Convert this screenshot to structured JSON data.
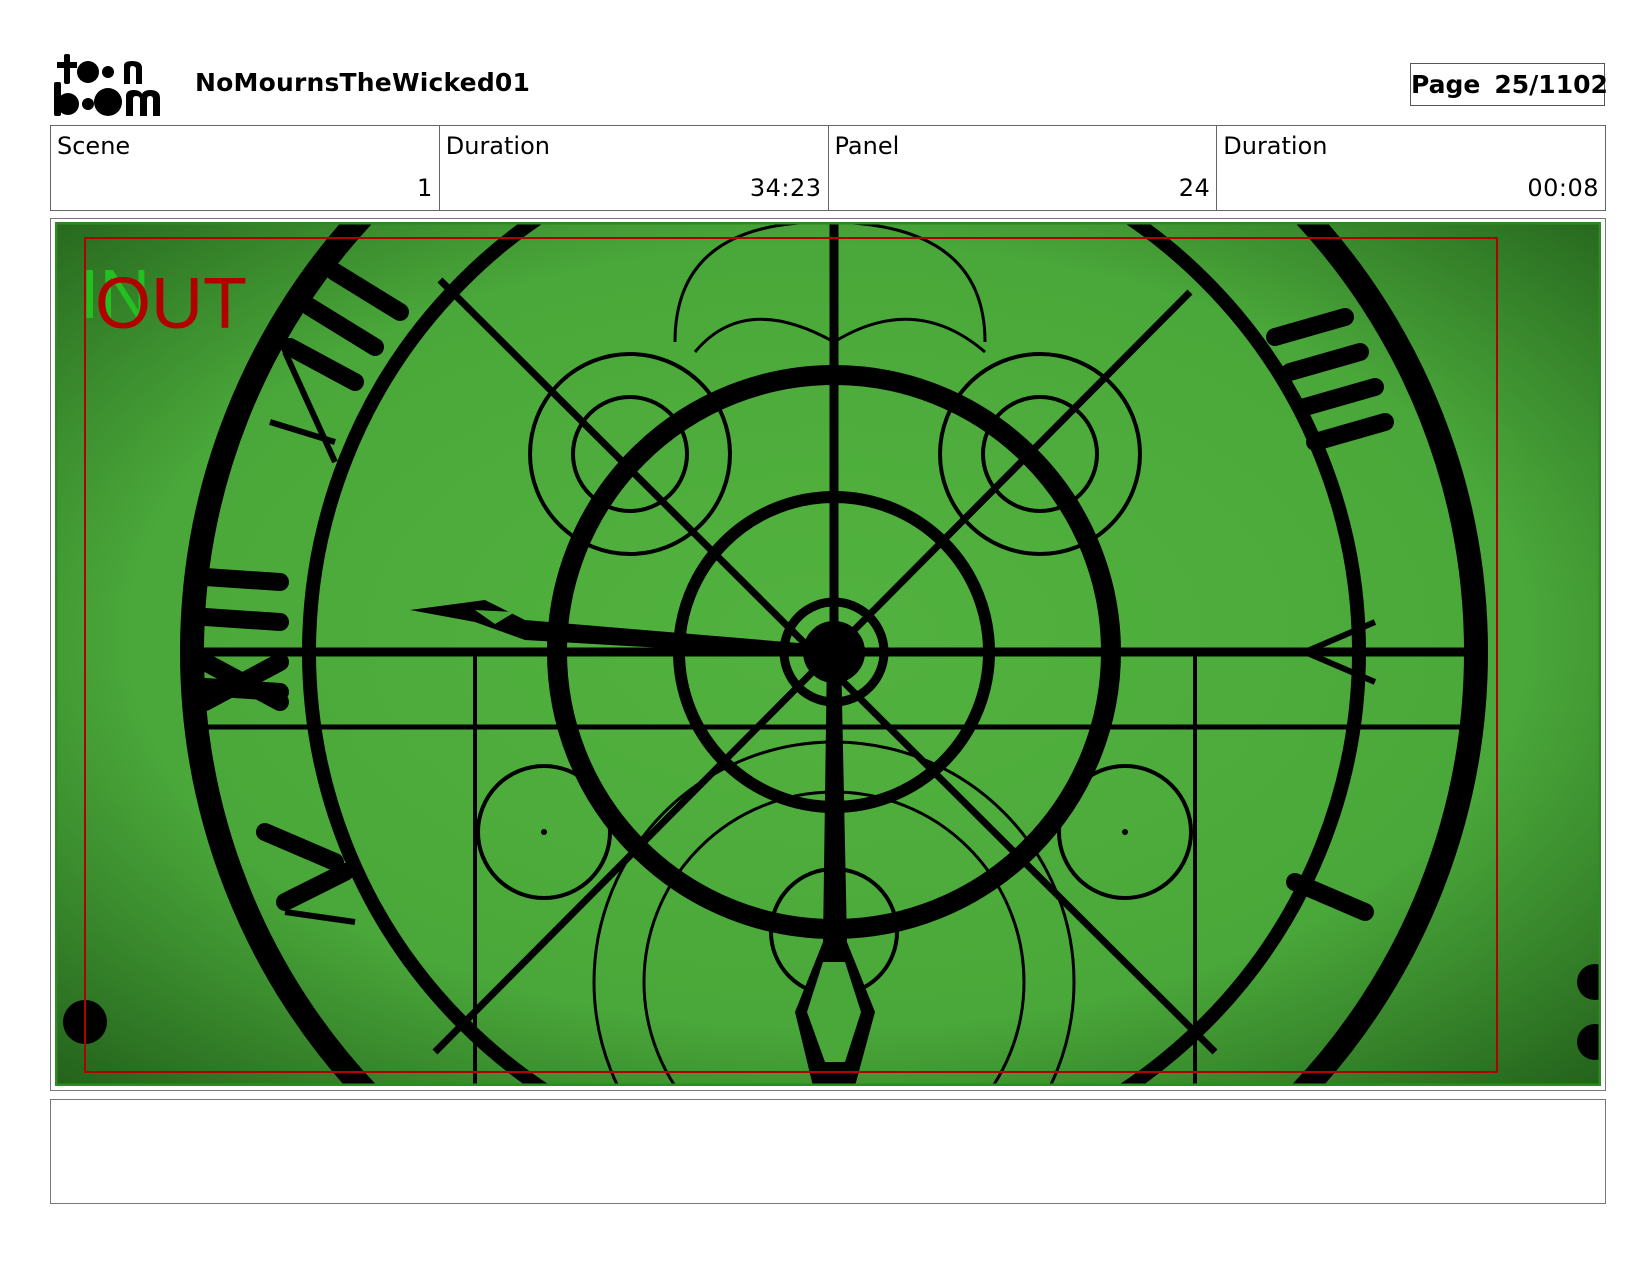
{
  "header": {
    "logo_alt": "toon boom",
    "project_title": "NoMournsTheWicked01",
    "page_label": "Page",
    "page_number": "25/1102"
  },
  "info": {
    "scene_label": "Scene",
    "scene_value": "1",
    "scene_duration_label": "Duration",
    "scene_duration_value": "34:23",
    "panel_label": "Panel",
    "panel_value": "24",
    "panel_duration_label": "Duration",
    "panel_duration_value": "00:08"
  },
  "panel": {
    "in_label": "IN",
    "out_label": "OUT",
    "colors": {
      "background": "#4caf3c",
      "vignette": "#1f5a18",
      "ink": "#000000",
      "in_marker": "#22c020",
      "out_marker": "#b00000"
    }
  },
  "notes": {
    "text": ""
  }
}
